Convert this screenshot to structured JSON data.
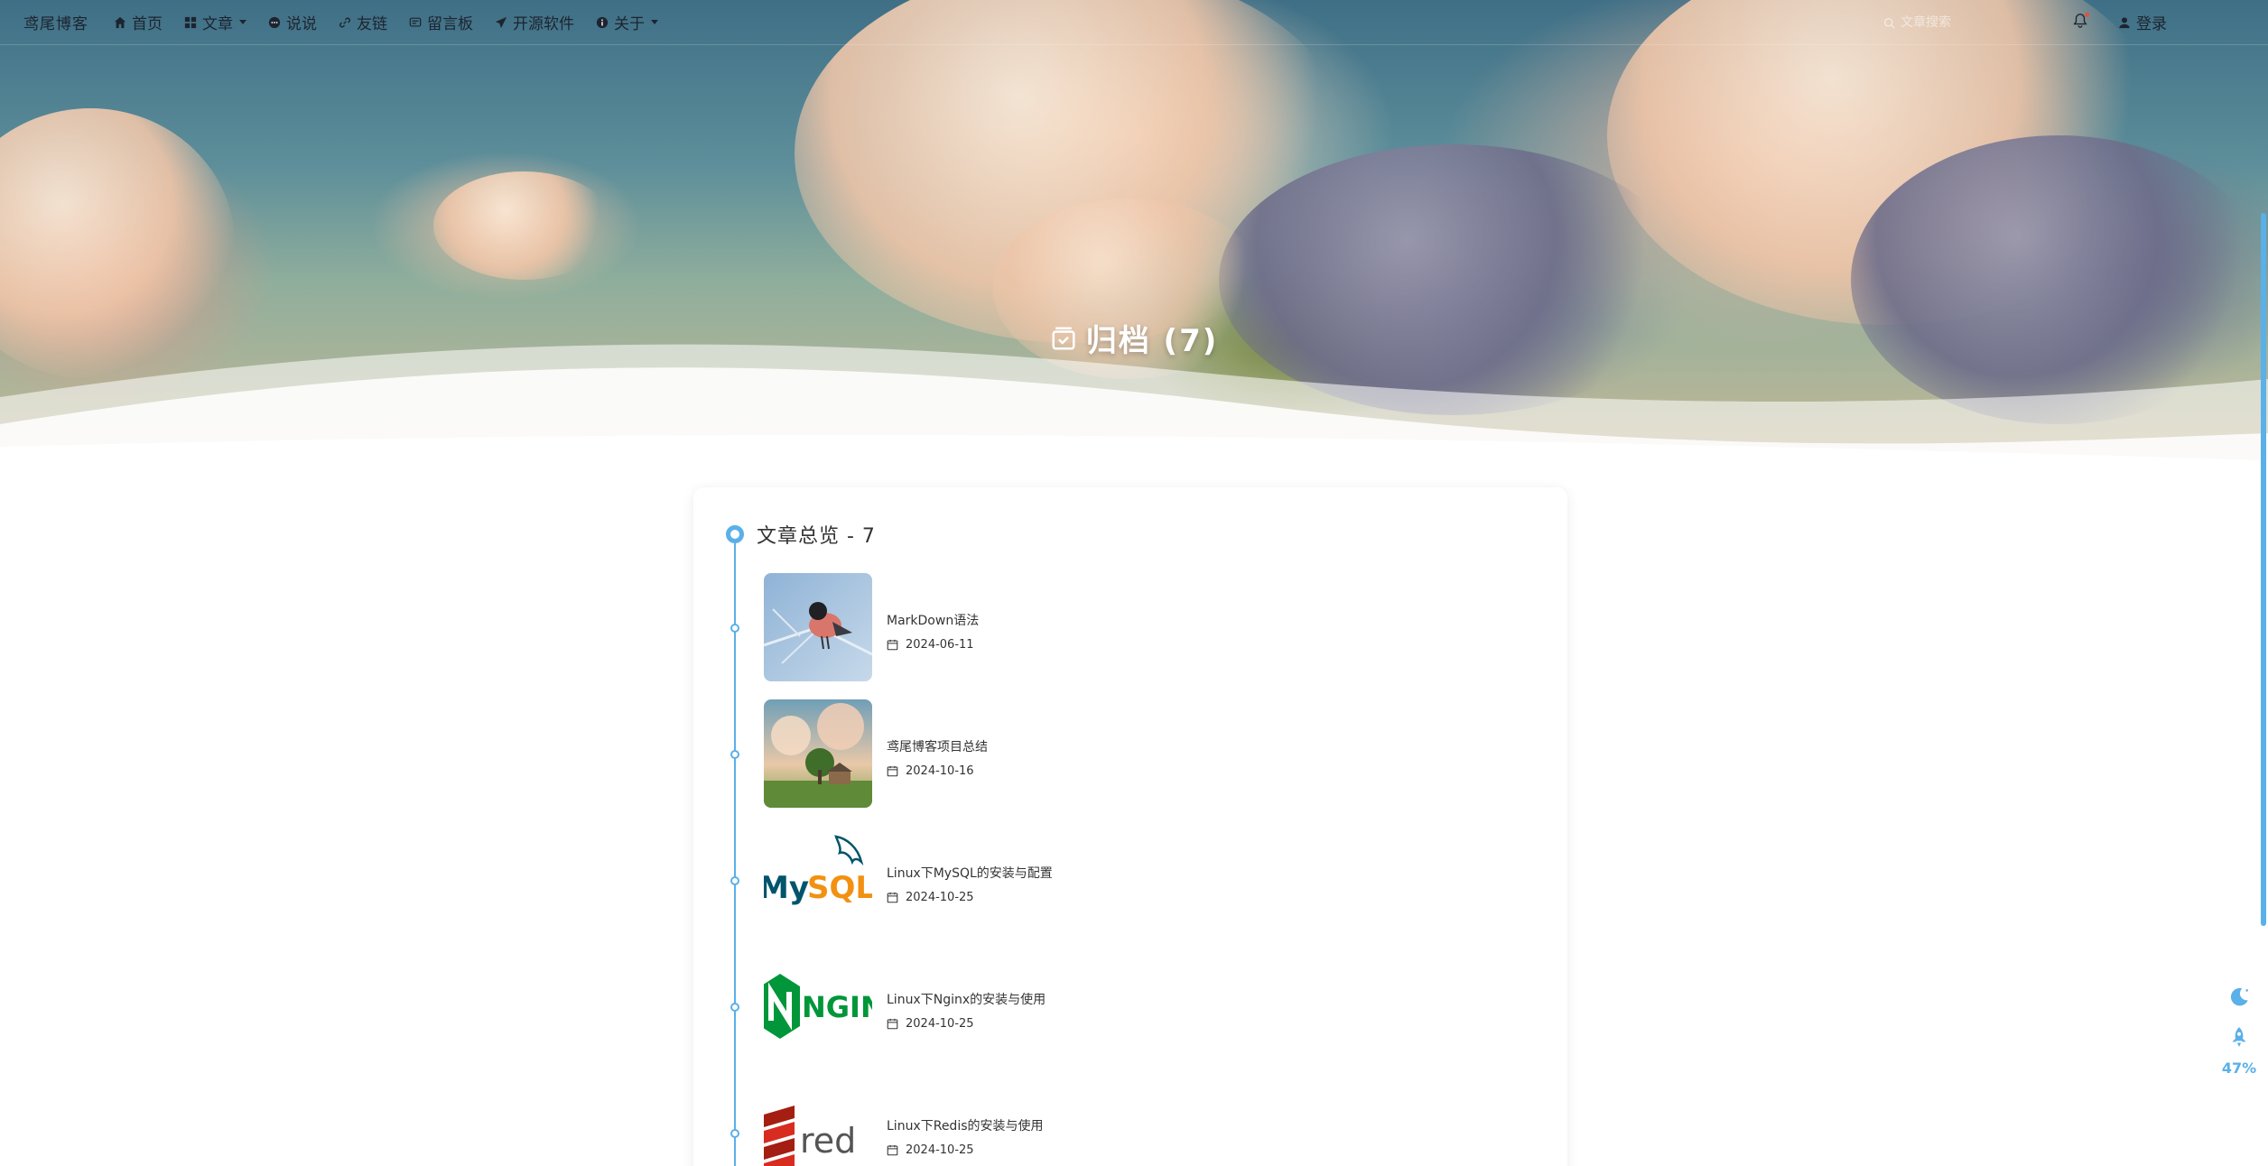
{
  "nav": {
    "brand": "鸢尾博客",
    "items": [
      {
        "label": "首页",
        "icon": "home-icon"
      },
      {
        "label": "文章",
        "icon": "grid-icon",
        "dropdown": true
      },
      {
        "label": "说说",
        "icon": "chat-icon"
      },
      {
        "label": "友链",
        "icon": "link-icon"
      },
      {
        "label": "留言板",
        "icon": "message-icon"
      },
      {
        "label": "开源软件",
        "icon": "send-icon"
      },
      {
        "label": "关于",
        "icon": "info-icon",
        "dropdown": true
      }
    ],
    "search_placeholder": "文章搜索",
    "login_label": "登录"
  },
  "hero": {
    "title": "归档 (7)"
  },
  "archive": {
    "overview_label": "文章总览 - 7",
    "posts": [
      {
        "title": "MarkDown语法",
        "date": "2024-06-11",
        "thumb": "bird"
      },
      {
        "title": "鸢尾博客项目总结",
        "date": "2024-10-16",
        "thumb": "landscape"
      },
      {
        "title": "Linux下MySQL的安装与配置",
        "date": "2024-10-25",
        "thumb": "mysql"
      },
      {
        "title": "Linux下Nginx的安装与使用",
        "date": "2024-10-25",
        "thumb": "nginx"
      },
      {
        "title": "Linux下Redis的安装与使用",
        "date": "2024-10-25",
        "thumb": "redis"
      }
    ]
  },
  "side_tools": {
    "scroll_percent": "47%"
  },
  "colors": {
    "accent": "#5ab0e8",
    "text": "#333333"
  }
}
